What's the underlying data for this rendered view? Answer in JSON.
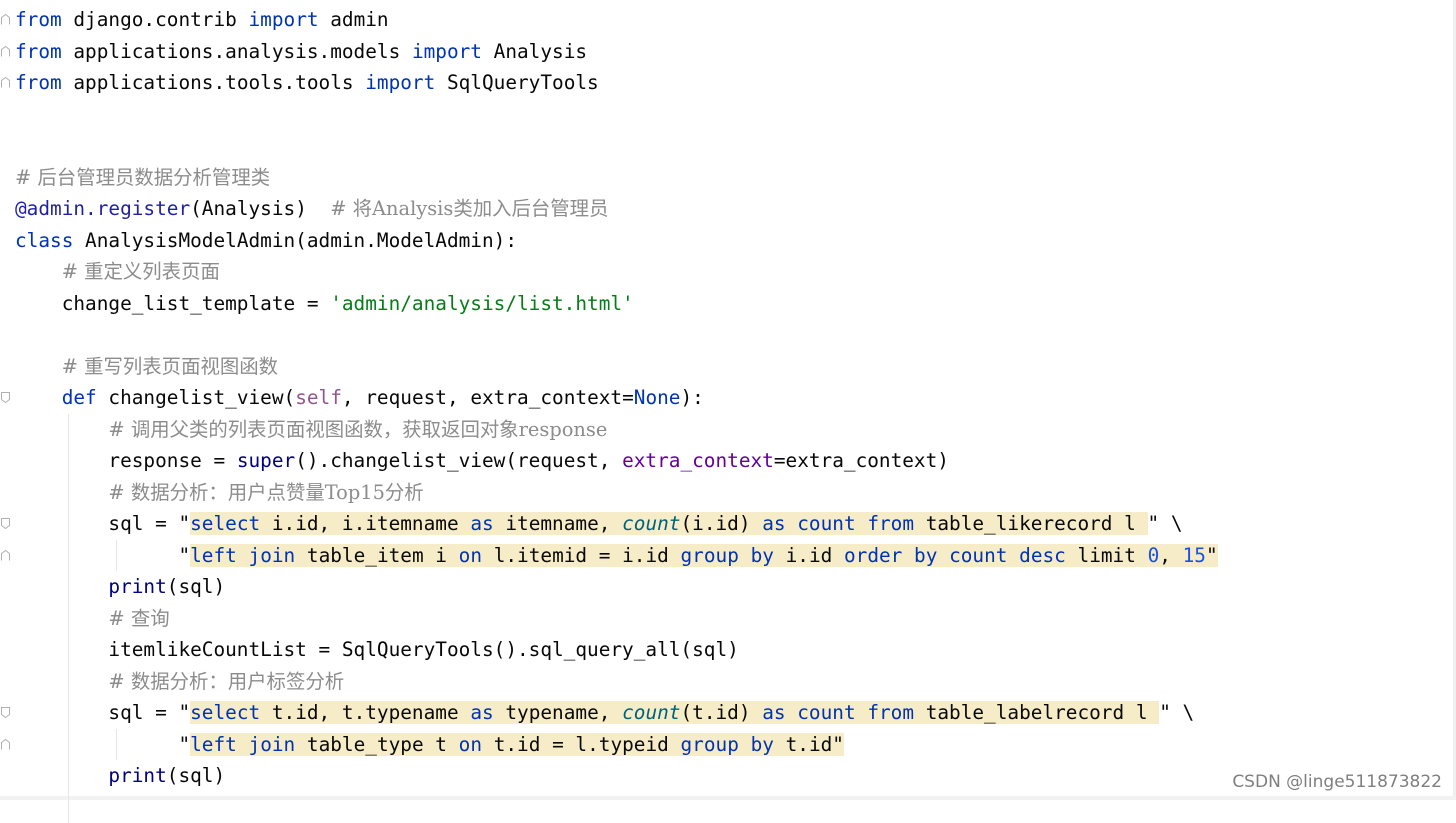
{
  "editor": {
    "language": "python",
    "colors": {
      "background": "#ffffff",
      "keyword": "#0033b3",
      "comment": "#8c8c8c",
      "string": "#067d17",
      "number": "#1750eb",
      "self": "#94558d",
      "kwarg": "#660099",
      "injection_bg": "#f7ecc8"
    },
    "lines": [
      [
        {
          "t": "from",
          "c": "kw"
        },
        {
          "t": " django.contrib "
        },
        {
          "t": "import",
          "c": "kw"
        },
        {
          "t": " admin"
        }
      ],
      [
        {
          "t": "from",
          "c": "kw"
        },
        {
          "t": " applications.analysis.models "
        },
        {
          "t": "import",
          "c": "kw"
        },
        {
          "t": " Analysis"
        }
      ],
      [
        {
          "t": "from",
          "c": "kw"
        },
        {
          "t": " applications.tools.tools "
        },
        {
          "t": "import",
          "c": "kw"
        },
        {
          "t": " SqlQueryTools"
        }
      ],
      [],
      [],
      [
        {
          "t": "# 后台管理员数据分析管理类",
          "c": "cm"
        }
      ],
      [
        {
          "t": "@admin.register",
          "c": "dec"
        },
        {
          "t": "(Analysis)  "
        },
        {
          "t": "# 将Analysis类加入后台管理员",
          "c": "cm"
        }
      ],
      [
        {
          "t": "class",
          "c": "kw"
        },
        {
          "t": " AnalysisModelAdmin(admin.ModelAdmin):"
        }
      ],
      [
        {
          "t": "    "
        },
        {
          "t": "# 重定义列表页面",
          "c": "cm"
        }
      ],
      [
        {
          "t": "    change_list_template = "
        },
        {
          "t": "'admin/analysis/list.html'",
          "c": "str"
        }
      ],
      [],
      [
        {
          "t": "    "
        },
        {
          "t": "# 重写列表页面视图函数",
          "c": "cm"
        }
      ],
      [
        {
          "t": "    "
        },
        {
          "t": "def",
          "c": "kw"
        },
        {
          "t": " changelist_view("
        },
        {
          "t": "self",
          "c": "self"
        },
        {
          "t": ", request, extra_context="
        },
        {
          "t": "None",
          "c": "kw"
        },
        {
          "t": "):"
        }
      ],
      [
        {
          "t": "        "
        },
        {
          "t": "# 调用父类的列表页面视图函数，获取返回对象response",
          "c": "cm"
        }
      ],
      [
        {
          "t": "        response = "
        },
        {
          "t": "super",
          "c": "fnbuiltin"
        },
        {
          "t": "().changelist_view(request, "
        },
        {
          "t": "extra_context",
          "c": "kwarg"
        },
        {
          "t": "=extra_context)"
        }
      ],
      [
        {
          "t": "        "
        },
        {
          "t": "# 数据分析：用户点赞量Top15分析",
          "c": "cm"
        }
      ],
      [
        {
          "t": "        sql = \""
        },
        {
          "t": "select",
          "c": "sqlkw",
          "i": 1
        },
        {
          "t": " i.id, i.itemname ",
          "i": 1
        },
        {
          "t": "as",
          "c": "sqlkw",
          "i": 1
        },
        {
          "t": " itemname, ",
          "i": 1
        },
        {
          "t": "count",
          "c": "sqlfn",
          "i": 1
        },
        {
          "t": "(i.id) ",
          "i": 1
        },
        {
          "t": "as",
          "c": "sqlkw",
          "i": 1
        },
        {
          "t": " ",
          "i": 1
        },
        {
          "t": "count",
          "c": "sqlkw",
          "i": 1
        },
        {
          "t": " ",
          "i": 1
        },
        {
          "t": "from",
          "c": "sqlkw",
          "i": 1
        },
        {
          "t": " table_likerecord l ",
          "i": 1
        },
        {
          "t": "\" \\"
        }
      ],
      [
        {
          "t": "              \""
        },
        {
          "t": "left",
          "c": "sqlkw",
          "i": 1
        },
        {
          "t": " ",
          "i": 1
        },
        {
          "t": "join",
          "c": "sqlkw",
          "i": 1
        },
        {
          "t": " table_item i ",
          "i": 1
        },
        {
          "t": "on",
          "c": "sqlkw",
          "i": 1
        },
        {
          "t": " l.itemid = i.id ",
          "i": 1
        },
        {
          "t": "group",
          "c": "sqlkw",
          "i": 1
        },
        {
          "t": " ",
          "i": 1
        },
        {
          "t": "by",
          "c": "sqlkw",
          "i": 1
        },
        {
          "t": " i.id ",
          "i": 1
        },
        {
          "t": "order",
          "c": "sqlkw",
          "i": 1
        },
        {
          "t": " ",
          "i": 1
        },
        {
          "t": "by",
          "c": "sqlkw",
          "i": 1
        },
        {
          "t": " ",
          "i": 1
        },
        {
          "t": "count",
          "c": "sqlkw",
          "i": 1
        },
        {
          "t": " ",
          "i": 1
        },
        {
          "t": "desc",
          "c": "sqlkw",
          "i": 1
        },
        {
          "t": " limit ",
          "i": 1
        },
        {
          "t": "0",
          "c": "num",
          "i": 1
        },
        {
          "t": ", ",
          "i": 1
        },
        {
          "t": "15",
          "c": "num",
          "i": 1
        },
        {
          "t": "\"",
          "i": 1
        }
      ],
      [
        {
          "t": "        "
        },
        {
          "t": "print",
          "c": "fnbuiltin"
        },
        {
          "t": "(sql)"
        }
      ],
      [
        {
          "t": "        "
        },
        {
          "t": "# 查询",
          "c": "cm"
        }
      ],
      [
        {
          "t": "        itemlikeCountList = SqlQueryTools().sql_query_all(sql)"
        }
      ],
      [
        {
          "t": "        "
        },
        {
          "t": "# 数据分析：用户标签分析",
          "c": "cm"
        }
      ],
      [
        {
          "t": "        sql = \""
        },
        {
          "t": "select",
          "c": "sqlkw",
          "i": 1
        },
        {
          "t": " t.id, t.typename ",
          "i": 1
        },
        {
          "t": "as",
          "c": "sqlkw",
          "i": 1
        },
        {
          "t": " typename, ",
          "i": 1
        },
        {
          "t": "count",
          "c": "sqlfn",
          "i": 1
        },
        {
          "t": "(t.id) ",
          "i": 1
        },
        {
          "t": "as",
          "c": "sqlkw",
          "i": 1
        },
        {
          "t": " ",
          "i": 1
        },
        {
          "t": "count",
          "c": "sqlkw",
          "i": 1
        },
        {
          "t": " ",
          "i": 1
        },
        {
          "t": "from",
          "c": "sqlkw",
          "i": 1
        },
        {
          "t": " table_labelrecord l ",
          "i": 1
        },
        {
          "t": "\" \\"
        }
      ],
      [
        {
          "t": "              \""
        },
        {
          "t": "left",
          "c": "sqlkw",
          "i": 1
        },
        {
          "t": " ",
          "i": 1
        },
        {
          "t": "join",
          "c": "sqlkw",
          "i": 1
        },
        {
          "t": " table_type t ",
          "i": 1
        },
        {
          "t": "on",
          "c": "sqlkw",
          "i": 1
        },
        {
          "t": " t.id = l.typeid ",
          "i": 1
        },
        {
          "t": "group",
          "c": "sqlkw",
          "i": 1
        },
        {
          "t": " ",
          "i": 1
        },
        {
          "t": "by",
          "c": "sqlkw",
          "i": 1
        },
        {
          "t": " t.id",
          "i": 1
        },
        {
          "t": "\"",
          "i": 1
        }
      ],
      [
        {
          "t": "        "
        },
        {
          "t": "print",
          "c": "fnbuiltin"
        },
        {
          "t": "(sql)"
        }
      ]
    ],
    "fold_markers": [
      {
        "line": 0,
        "icon": "fold-end-icon"
      },
      {
        "line": 1,
        "icon": "fold-end-icon"
      },
      {
        "line": 2,
        "icon": "fold-end-icon"
      },
      {
        "line": 12,
        "icon": "fold-start-icon"
      },
      {
        "line": 16,
        "icon": "fold-start-icon"
      },
      {
        "line": 17,
        "icon": "fold-end-icon"
      },
      {
        "line": 22,
        "icon": "fold-start-icon"
      },
      {
        "line": 23,
        "icon": "fold-end-icon"
      }
    ]
  },
  "watermark": "CSDN @linge511873822"
}
